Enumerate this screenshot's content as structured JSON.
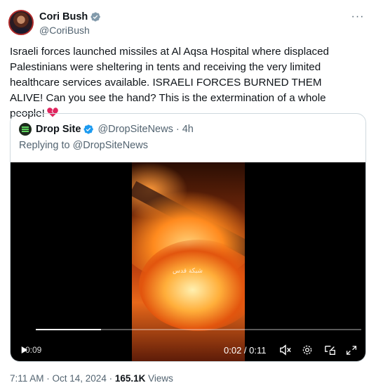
{
  "author": {
    "name": "Cori Bush",
    "handle": "@CoriBush",
    "verified_color": "#829aab"
  },
  "more_menu": "···",
  "tweet": {
    "text": "Israeli forces launched missiles at Al Aqsa Hospital where displaced Palestinians were sheltering in tents and receiving the very limited healthcare services available. ISRAELI FORCES BURNED THEM ALIVE! Can you see the hand? This is the extermination of a whole people!",
    "emoji": "broken-heart-icon"
  },
  "quote": {
    "name": "Drop Site",
    "handle": "@DropSiteNews",
    "separator": "·",
    "time": "4h",
    "replying_to": "Replying to @DropSiteNews",
    "verified_color": "#1d9bf0"
  },
  "video": {
    "watermark": "شبكة قدس",
    "elapsed_overlay": "0:09",
    "current_time": "0:02 / 0:11",
    "progress": 0.2,
    "controls": [
      "play-icon",
      "mute-icon",
      "settings-icon",
      "pip-icon",
      "fullscreen-icon"
    ]
  },
  "meta": {
    "timestamp": "7:11 AM · Oct 14, 2024 · ",
    "views_count": "165.1K",
    "views_label": " Views"
  },
  "colors": {
    "text": "#0f1419",
    "muted": "#536471",
    "border": "#cfd9de",
    "heart": "#e0245e"
  }
}
